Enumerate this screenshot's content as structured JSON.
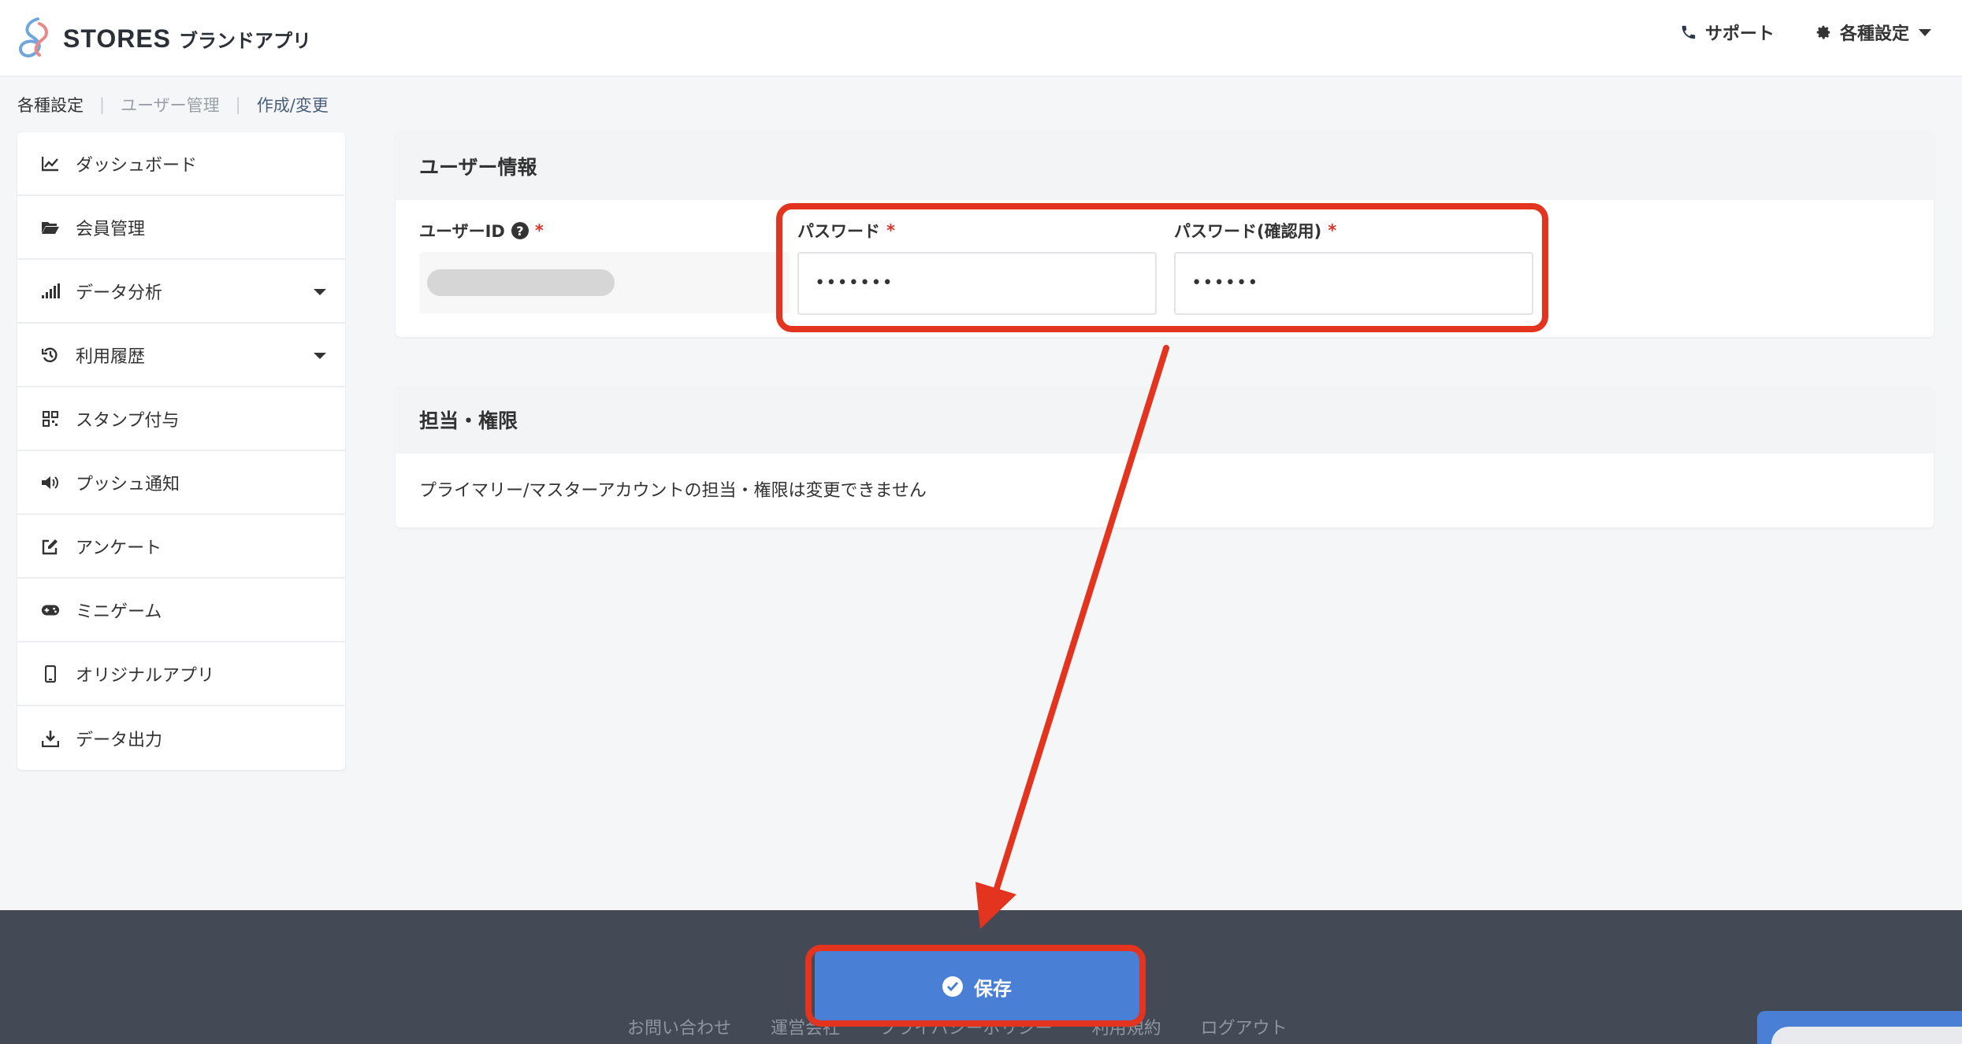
{
  "header": {
    "brand": "STORES",
    "brand_sub": "ブランドアプリ",
    "support_label": "サポート",
    "settings_label": "各種設定"
  },
  "breadcrumb": {
    "items": [
      "各種設定",
      "ユーザー管理",
      "作成/変更"
    ]
  },
  "sidebar": {
    "items": [
      {
        "label": "ダッシュボード",
        "icon": "chart-line-icon"
      },
      {
        "label": "会員管理",
        "icon": "folder-open-icon"
      },
      {
        "label": "データ分析",
        "icon": "signal-bars-icon"
      },
      {
        "label": "利用履歴",
        "icon": "history-icon"
      },
      {
        "label": "スタンプ付与",
        "icon": "qrcode-icon"
      },
      {
        "label": "プッシュ通知",
        "icon": "volume-icon"
      },
      {
        "label": "アンケート",
        "icon": "edit-icon"
      },
      {
        "label": "ミニゲーム",
        "icon": "gamepad-icon"
      },
      {
        "label": "オリジナルアプリ",
        "icon": "mobile-icon"
      },
      {
        "label": "データ出力",
        "icon": "download-icon"
      }
    ]
  },
  "user_info": {
    "title": "ユーザー情報",
    "userid_label": "ユーザーID",
    "password_label": "パスワード",
    "password_value": "•••••••",
    "password_confirm_label": "パスワード(確認用)",
    "password_confirm_value": "••••••",
    "required_mark": "*",
    "help_mark": "?"
  },
  "role": {
    "title": "担当・権限",
    "message": "プライマリー/マスターアカウントの担当・権限は変更できません"
  },
  "footer": {
    "save_label": "保存",
    "links": [
      "お問い合わせ",
      "運営会社",
      "プライバシーポリシー",
      "利用規約",
      "ログアウト"
    ]
  },
  "colors": {
    "accent": "#4a7fd6",
    "highlight": "#e2341f",
    "footer_bg": "#434a55"
  }
}
